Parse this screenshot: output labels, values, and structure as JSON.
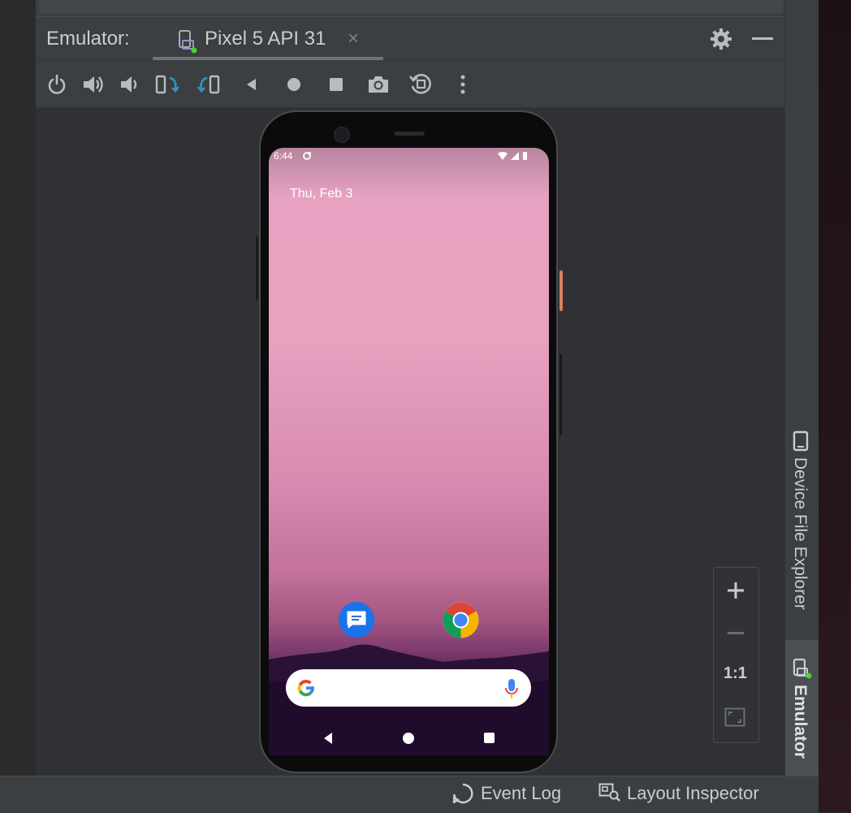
{
  "header": {
    "title": "Emulator:",
    "tab_label": "Pixel 5 API 31",
    "tab_close": "×"
  },
  "toolbar": {
    "buttons": [
      "power-icon",
      "volume-up-icon",
      "volume-down-icon",
      "rotate-left-icon",
      "rotate-right-icon",
      "back-icon",
      "home-icon",
      "overview-icon",
      "screenshot-icon",
      "snapshot-icon",
      "more-icon"
    ]
  },
  "device": {
    "status_time": "6:44",
    "date": "Thu, Feb 3",
    "apps": [
      "messages-app",
      "chrome-app"
    ],
    "wallpaper_colors": [
      "#e8a3c0",
      "#a2557f",
      "#1e0c2c"
    ]
  },
  "zoom": {
    "zoom_in": "+",
    "actual_size": "1:1"
  },
  "side_tabs": {
    "device_file_explorer": "Device File Explorer",
    "emulator": "Emulator"
  },
  "status_bar": {
    "event_log": "Event Log",
    "layout_inspector": "Layout Inspector"
  },
  "colors": {
    "panel_bg": "#3c3f41",
    "canvas_bg": "#2f3134",
    "accent_blue": "#3592c4",
    "running_green": "#4cd137"
  }
}
